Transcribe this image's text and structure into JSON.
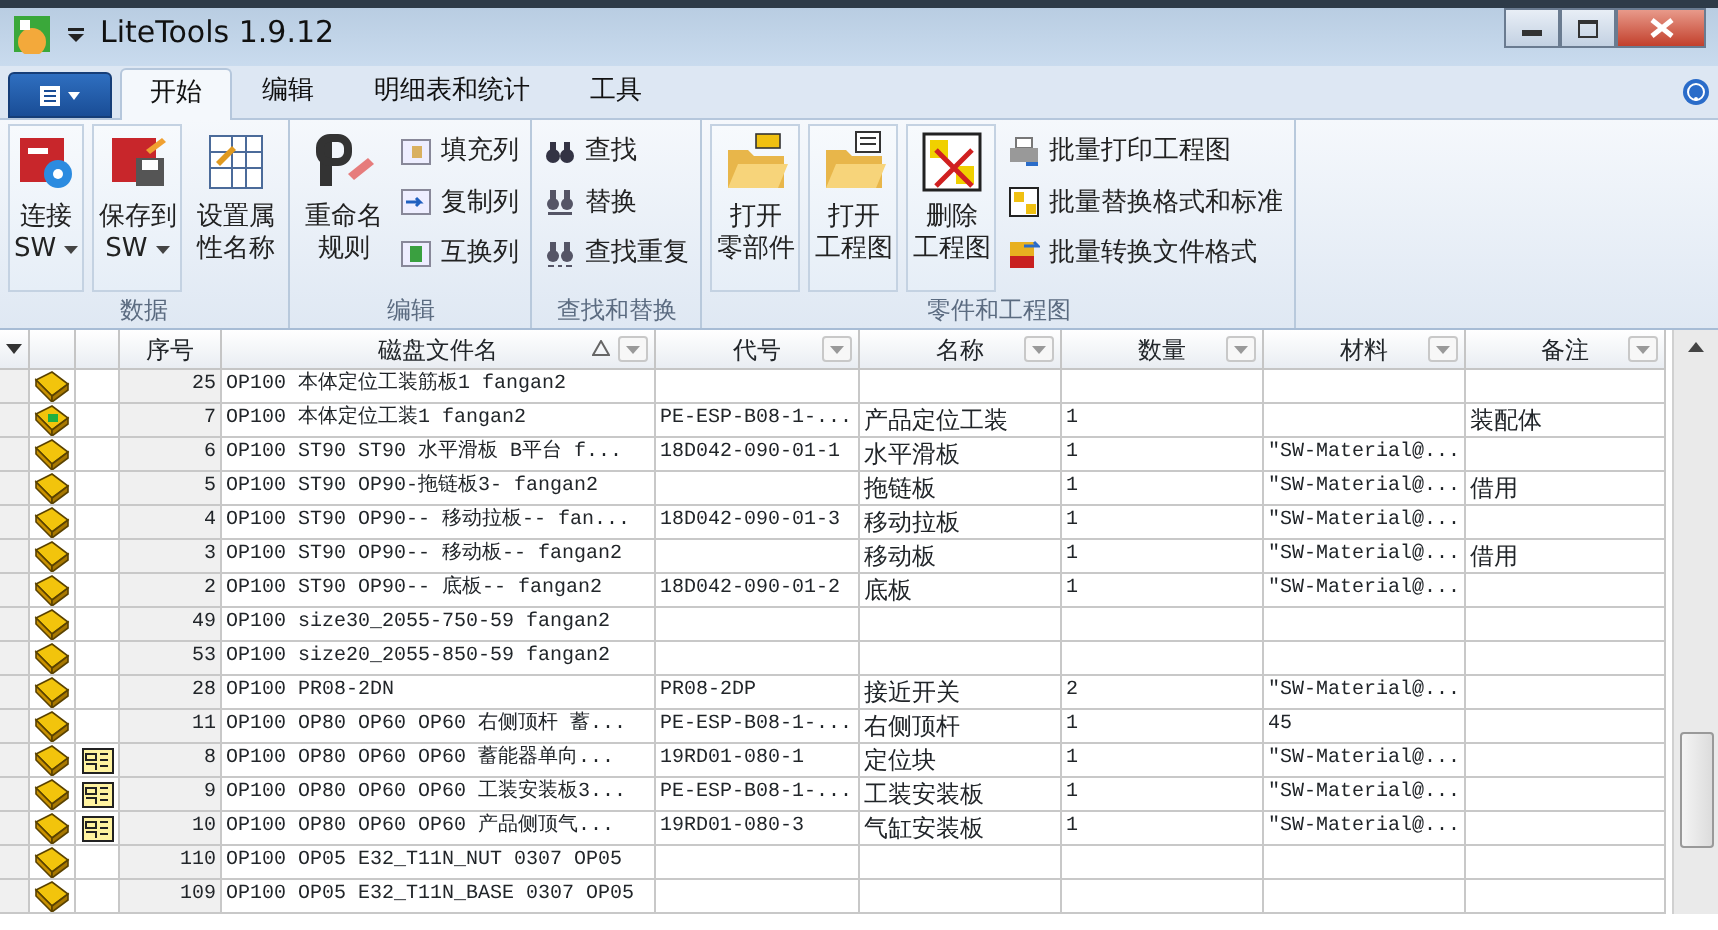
{
  "window": {
    "title": "LiteTools 1.9.12"
  },
  "tabs": [
    {
      "label": "开始",
      "selected": true
    },
    {
      "label": "编辑",
      "selected": false
    },
    {
      "label": "明细表和统计",
      "selected": false
    },
    {
      "label": "工具",
      "selected": false
    }
  ],
  "ribbon_groups": [
    {
      "label": "数据",
      "items": [
        {
          "kind": "large",
          "lines": [
            "连接",
            "SW"
          ],
          "dropdown": true
        },
        {
          "kind": "large",
          "lines": [
            "保存到",
            "SW"
          ],
          "dropdown": true
        },
        {
          "kind": "large",
          "lines": [
            "设置属",
            "性名称"
          ],
          "dropdown": false
        }
      ]
    },
    {
      "label": "编辑",
      "items": [
        {
          "kind": "large",
          "lines": [
            "重命名",
            "规则"
          ],
          "dropdown": false
        },
        {
          "kind": "small",
          "lines": [
            "填充列"
          ]
        },
        {
          "kind": "small",
          "lines": [
            "复制列"
          ]
        },
        {
          "kind": "small",
          "lines": [
            "互换列"
          ]
        }
      ]
    },
    {
      "label": "查找和替换",
      "items": [
        {
          "kind": "small",
          "lines": [
            "查找"
          ]
        },
        {
          "kind": "small",
          "lines": [
            "替换"
          ]
        },
        {
          "kind": "small",
          "lines": [
            "查找重复"
          ]
        }
      ]
    },
    {
      "label": "零件和工程图",
      "items": [
        {
          "kind": "large",
          "lines": [
            "打开",
            "零部件"
          ],
          "dropdown": false
        },
        {
          "kind": "large",
          "lines": [
            "打开",
            "工程图"
          ],
          "dropdown": false
        },
        {
          "kind": "large",
          "lines": [
            "删除",
            "工程图"
          ],
          "dropdown": false
        },
        {
          "kind": "small",
          "lines": [
            "批量打印工程图"
          ]
        },
        {
          "kind": "small",
          "lines": [
            "批量替换格式和标准"
          ]
        },
        {
          "kind": "small",
          "lines": [
            "批量转换文件格式"
          ]
        }
      ]
    }
  ],
  "table": {
    "columns": [
      {
        "label": "序号",
        "sorted": false,
        "filter": false
      },
      {
        "label": "磁盘文件名",
        "sorted": true,
        "filter": true
      },
      {
        "label": "代号",
        "sorted": false,
        "filter": true
      },
      {
        "label": "名称",
        "sorted": false,
        "filter": true
      },
      {
        "label": "数量",
        "sorted": false,
        "filter": true
      },
      {
        "label": "材料",
        "sorted": false,
        "filter": true
      },
      {
        "label": "备注",
        "sorted": false,
        "filter": true
      }
    ],
    "rows": [
      {
        "kind": "part",
        "drawing": false,
        "cells": [
          "25",
          "OP100 本体定位工装筋板1 fangan2",
          "",
          "",
          "",
          "",
          ""
        ]
      },
      {
        "kind": "assembly",
        "drawing": false,
        "cells": [
          "7",
          "OP100 本体定位工装1 fangan2",
          "PE-ESP-B08-1-...",
          "产品定位工装",
          "1",
          "",
          "装配体"
        ]
      },
      {
        "kind": "part",
        "drawing": false,
        "cells": [
          "6",
          "OP100 ST90 ST90 水平滑板 B平台 f...",
          "18D042-090-01-1",
          "水平滑板",
          "1",
          "\"SW-Material@...",
          ""
        ]
      },
      {
        "kind": "part",
        "drawing": false,
        "cells": [
          "5",
          "OP100 ST90 OP90-拖链板3- fangan2",
          "",
          "拖链板",
          "1",
          "\"SW-Material@...",
          "借用"
        ]
      },
      {
        "kind": "part",
        "drawing": false,
        "cells": [
          "4",
          "OP100 ST90 OP90-- 移动拉板-- fan...",
          "18D042-090-01-3",
          "移动拉板",
          "1",
          "\"SW-Material@...",
          ""
        ]
      },
      {
        "kind": "part",
        "drawing": false,
        "cells": [
          "3",
          "OP100 ST90 OP90-- 移动板-- fangan2",
          "",
          "移动板",
          "1",
          "\"SW-Material@...",
          "借用"
        ]
      },
      {
        "kind": "part",
        "drawing": false,
        "cells": [
          "2",
          "OP100 ST90 OP90-- 底板-- fangan2",
          "18D042-090-01-2",
          "底板",
          "1",
          "\"SW-Material@...",
          ""
        ]
      },
      {
        "kind": "part",
        "drawing": false,
        "cells": [
          "49",
          "OP100 size30_2055-750-59 fangan2",
          "",
          "",
          "",
          "",
          ""
        ]
      },
      {
        "kind": "part",
        "drawing": false,
        "cells": [
          "53",
          "OP100 size20_2055-850-59 fangan2",
          "",
          "",
          "",
          "",
          ""
        ]
      },
      {
        "kind": "part",
        "drawing": false,
        "cells": [
          "28",
          "OP100 PR08-2DN",
          "PR08-2DP",
          "接近开关",
          "2",
          "\"SW-Material@...",
          ""
        ]
      },
      {
        "kind": "part",
        "drawing": false,
        "cells": [
          "11",
          "OP100 OP80 OP60 OP60 右侧顶杆 蓄...",
          "PE-ESP-B08-1-...",
          "右侧顶杆",
          "1",
          "45",
          ""
        ]
      },
      {
        "kind": "part",
        "drawing": true,
        "cells": [
          "8",
          "OP100 OP80 OP60 OP60 蓄能器单向...",
          "19RD01-080-1",
          "定位块",
          "1",
          "\"SW-Material@...",
          ""
        ]
      },
      {
        "kind": "part",
        "drawing": true,
        "cells": [
          "9",
          "OP100 OP80 OP60 OP60 工装安装板3...",
          "PE-ESP-B08-1-...",
          "工装安装板",
          "1",
          "\"SW-Material@...",
          ""
        ]
      },
      {
        "kind": "part",
        "drawing": true,
        "cells": [
          "10",
          "OP100 OP80 OP60 OP60 产品侧顶气...",
          "19RD01-080-3",
          "气缸安装板",
          "1",
          "\"SW-Material@...",
          ""
        ]
      },
      {
        "kind": "part",
        "drawing": false,
        "cells": [
          "110",
          "OP100 OP05 E32_T11N_NUT 0307 OP05",
          "",
          "",
          "",
          "",
          ""
        ]
      },
      {
        "kind": "part",
        "drawing": false,
        "cells": [
          "109",
          "OP100 OP05 E32_T11N_BASE 0307 OP05",
          "",
          "",
          "",
          "",
          ""
        ]
      }
    ]
  }
}
